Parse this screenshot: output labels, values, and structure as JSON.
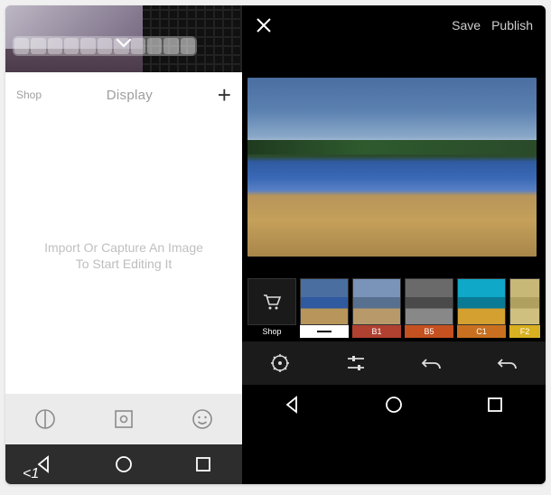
{
  "left": {
    "shop_label": "Shop",
    "title": "Display",
    "empty_line1": "Import Or Capture An Image",
    "empty_line2": "To Start Editing It",
    "toolbar": {
      "icon1": "circle-split-icon",
      "icon2": "focus-square-icon",
      "icon3": "smiley-icon"
    },
    "nav_badge": "<1"
  },
  "right": {
    "save_label": "Save",
    "publish_label": "Publish",
    "filters": {
      "shop_label": "Shop",
      "items": [
        {
          "id": "original",
          "label": ""
        },
        {
          "id": "B1",
          "label": "B1"
        },
        {
          "id": "B5",
          "label": "B5"
        },
        {
          "id": "C1",
          "label": "C1"
        },
        {
          "id": "F2",
          "label": "F2"
        }
      ]
    },
    "tools": {
      "preset": "preset-wheel-icon",
      "adjust": "sliders-icon",
      "undo": "undo-icon",
      "redo": "redo-icon"
    }
  }
}
